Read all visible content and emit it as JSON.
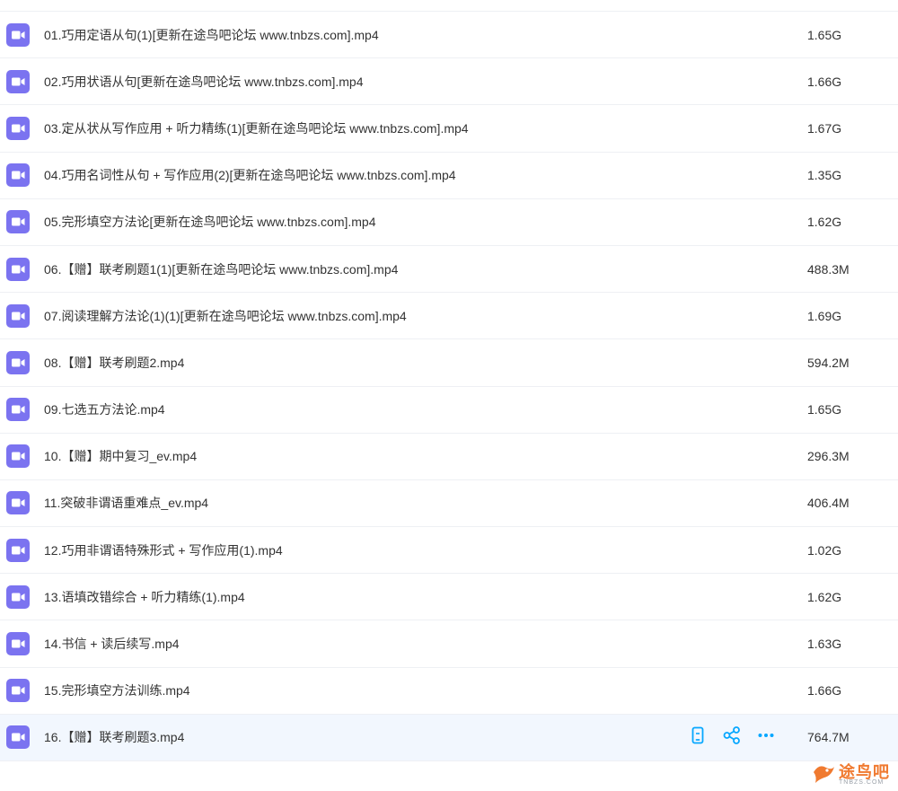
{
  "colors": {
    "icon_bg": "#7b73f0",
    "accent": "#06a7ff",
    "row_hover": "#f2f7fe",
    "divider": "#eef0f4",
    "watermark": "#f07a30"
  },
  "file_icon": "video-file-icon",
  "files": [
    {
      "name": "01.巧用定语从句(1)[更新在途鸟吧论坛 www.tnbzs.com].mp4",
      "size": "1.65G"
    },
    {
      "name": "02.巧用状语从句[更新在途鸟吧论坛 www.tnbzs.com].mp4",
      "size": "1.66G"
    },
    {
      "name": "03.定从状从写作应用 + 听力精练(1)[更新在途鸟吧论坛 www.tnbzs.com].mp4",
      "size": "1.67G"
    },
    {
      "name": "04.巧用名词性从句 + 写作应用(2)[更新在途鸟吧论坛 www.tnbzs.com].mp4",
      "size": "1.35G"
    },
    {
      "name": "05.完形填空方法论[更新在途鸟吧论坛 www.tnbzs.com].mp4",
      "size": "1.62G"
    },
    {
      "name": "06.【赠】联考刷题1(1)[更新在途鸟吧论坛 www.tnbzs.com].mp4",
      "size": "488.3M"
    },
    {
      "name": "07.阅读理解方法论(1)(1)[更新在途鸟吧论坛 www.tnbzs.com].mp4",
      "size": "1.69G"
    },
    {
      "name": "08.【赠】联考刷题2.mp4",
      "size": "594.2M"
    },
    {
      "name": "09.七选五方法论.mp4",
      "size": "1.65G"
    },
    {
      "name": "10.【赠】期中复习_ev.mp4",
      "size": "296.3M"
    },
    {
      "name": "11.突破非谓语重难点_ev.mp4",
      "size": "406.4M"
    },
    {
      "name": "12.巧用非谓语特殊形式 + 写作应用(1).mp4",
      "size": "1.02G"
    },
    {
      "name": "13.语填改错综合 + 听力精练(1).mp4",
      "size": "1.62G"
    },
    {
      "name": "14.书信 + 读后续写.mp4",
      "size": "1.63G"
    },
    {
      "name": "15.完形填空方法训练.mp4",
      "size": "1.66G"
    },
    {
      "name": "16.【赠】联考刷题3.mp4",
      "size": "764.7M"
    }
  ],
  "active_row_index": 15,
  "row_actions": [
    {
      "icon": "phone-icon",
      "name": "send-to-phone-button"
    },
    {
      "icon": "share-icon",
      "name": "share-button"
    },
    {
      "icon": "more-icon",
      "name": "more-button"
    }
  ],
  "watermark": {
    "text": "途鸟吧",
    "sub": "TNBZS.COM"
  }
}
